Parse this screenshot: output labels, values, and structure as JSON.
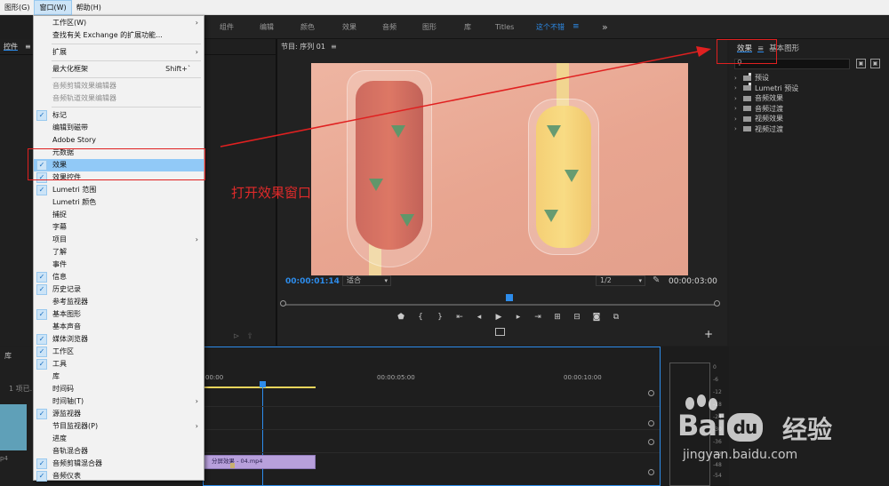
{
  "menubar": {
    "items": [
      "图形(G)",
      "窗口(W)",
      "帮助(H)"
    ]
  },
  "workspaces": {
    "tabs": [
      "组件",
      "编辑",
      "颜色",
      "效果",
      "音频",
      "图形",
      "库",
      "Titles",
      "这个不错"
    ],
    "menu_icon": "≡",
    "more": "»"
  },
  "left_panel": {
    "tab": "控件",
    "tab_menu": "≡"
  },
  "project_panel": {
    "tab": "库",
    "count": "1 项已...",
    "clip_label": "p4"
  },
  "program_monitor": {
    "title": "节目: 序列 01",
    "menu_icon": "≡",
    "timecode_current": "00:00:01:14",
    "fit": "适合",
    "resolution": "1/2",
    "timecode_total": "00:00:03:00",
    "scrub_progress": 0.52
  },
  "effects_panel": {
    "tab_effects": "效果",
    "tab_menu": "≡",
    "tab_essential": "基本图形",
    "items": [
      "预设",
      "Lumetri 预设",
      "音频效果",
      "音频过渡",
      "视频效果",
      "视频过渡"
    ]
  },
  "timeline": {
    "ruler": [
      "00:00",
      "00:00:05:00",
      "00:00:10:00"
    ],
    "clip_name": "分屏效果 - 04.mp4"
  },
  "meters": {
    "labels": [
      "0",
      "-6",
      "-12",
      "-18",
      "-24",
      "-30",
      "-36",
      "-42",
      "-48",
      "-54"
    ]
  },
  "window_menu": {
    "items": [
      {
        "label": "工作区(W)",
        "arrow": true
      },
      {
        "label": "查找有关 Exchange 的扩展功能..."
      },
      {
        "sep": true
      },
      {
        "label": "扩展",
        "arrow": true
      },
      {
        "sep": true
      },
      {
        "label": "最大化框架",
        "shortcut": "Shift+`"
      },
      {
        "sep": true
      },
      {
        "label": "音频剪辑效果编辑器",
        "disabled": true
      },
      {
        "label": "音频轨道效果编辑器",
        "disabled": true
      },
      {
        "sep": true
      },
      {
        "label": "标记",
        "checked": true
      },
      {
        "label": "编辑到磁带"
      },
      {
        "label": "Adobe Story"
      },
      {
        "label": "元数据"
      },
      {
        "label": "效果",
        "checked": true,
        "highlight": true
      },
      {
        "label": "效果控件",
        "checked": true
      },
      {
        "label": "Lumetri 范围",
        "checked": true
      },
      {
        "label": "Lumetri 颜色"
      },
      {
        "label": "捕捉"
      },
      {
        "label": "字幕"
      },
      {
        "label": "项目",
        "arrow": true
      },
      {
        "label": "了解"
      },
      {
        "label": "事件"
      },
      {
        "label": "信息",
        "checked": true
      },
      {
        "label": "历史记录",
        "checked": true
      },
      {
        "label": "参考监视器"
      },
      {
        "label": "基本图形",
        "checked": true
      },
      {
        "label": "基本声音"
      },
      {
        "label": "媒体浏览器",
        "checked": true
      },
      {
        "label": "工作区",
        "checked": true
      },
      {
        "label": "工具",
        "checked": true
      },
      {
        "label": "库"
      },
      {
        "label": "时间码"
      },
      {
        "label": "时间轴(T)",
        "arrow": true
      },
      {
        "label": "源监视器",
        "checked": true
      },
      {
        "label": "节目监视器(P)",
        "arrow": true
      },
      {
        "label": "进度"
      },
      {
        "label": "音轨混合器"
      },
      {
        "label": "音频剪辑混合器",
        "checked": true
      },
      {
        "label": "音频仪表",
        "checked": true
      }
    ]
  },
  "annotation": {
    "text": "打开效果窗口",
    "color": "#e02a2a"
  },
  "watermark": {
    "brand": "Bai",
    "brand2": "du",
    "cn": "经验",
    "url": "jingyan.baidu.com"
  },
  "colors": {
    "accent": "#2d8ceb",
    "menu_highlight": "#91c9f7",
    "annotation": "#e02020"
  }
}
